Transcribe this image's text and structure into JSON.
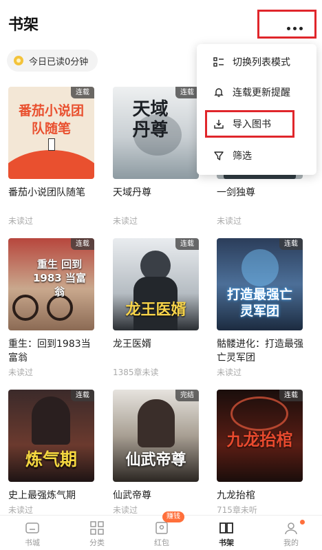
{
  "header": {
    "title": "书架",
    "more_icon": "more-horizontal-icon"
  },
  "reading": {
    "text": "今日已读0分钟",
    "icon": "clock-icon"
  },
  "menu": {
    "items": [
      {
        "label": "切换列表模式",
        "icon": "list-mode-icon"
      },
      {
        "label": "连载更新提醒",
        "icon": "bell-icon"
      },
      {
        "label": "导入图书",
        "icon": "import-icon"
      },
      {
        "label": "筛选",
        "icon": "filter-icon"
      }
    ],
    "highlight_color": "#e0262b"
  },
  "books": [
    {
      "title": "番茄小说团队随笔",
      "badge": "连载",
      "status": "未读过",
      "cover_text": "番茄小说团队随笔"
    },
    {
      "title": "天域丹尊",
      "badge": "连载",
      "status": "未读过",
      "cover_text": "天域丹尊"
    },
    {
      "title": "一剑独尊",
      "badge": "",
      "status": "未读过",
      "cover_text": ""
    },
    {
      "title": "重生：回到1983当富翁",
      "badge": "连载",
      "status": "未读过",
      "cover_text": "重生 回到1983 当富翁"
    },
    {
      "title": "龙王医婿",
      "badge": "连载",
      "status": "1385章未读",
      "cover_text": "龙王医婿"
    },
    {
      "title": "骷髅进化：打造最强亡灵军团",
      "badge": "连载",
      "status": "未读过",
      "cover_text": "打造最强亡灵军团"
    },
    {
      "title": "史上最强炼气期",
      "badge": "连载",
      "status": "未读过",
      "cover_text": "炼气期"
    },
    {
      "title": "仙武帝尊",
      "badge": "完结",
      "status": "未读过",
      "cover_text": "仙武帝尊"
    },
    {
      "title": "九龙抬棺",
      "badge": "连载",
      "status": "715章未听",
      "cover_text": "九龙抬棺"
    }
  ],
  "tabs": [
    {
      "label": "书城",
      "icon": "home-icon",
      "active": false
    },
    {
      "label": "分类",
      "icon": "grid-icon",
      "active": false
    },
    {
      "label": "红包",
      "icon": "red-packet-icon",
      "active": false,
      "badge": "赚钱"
    },
    {
      "label": "书架",
      "icon": "bookshelf-icon",
      "active": true
    },
    {
      "label": "我的",
      "icon": "user-icon",
      "active": false
    }
  ],
  "colors": {
    "accent": "#ff6f3b",
    "highlight": "#e0262b"
  }
}
